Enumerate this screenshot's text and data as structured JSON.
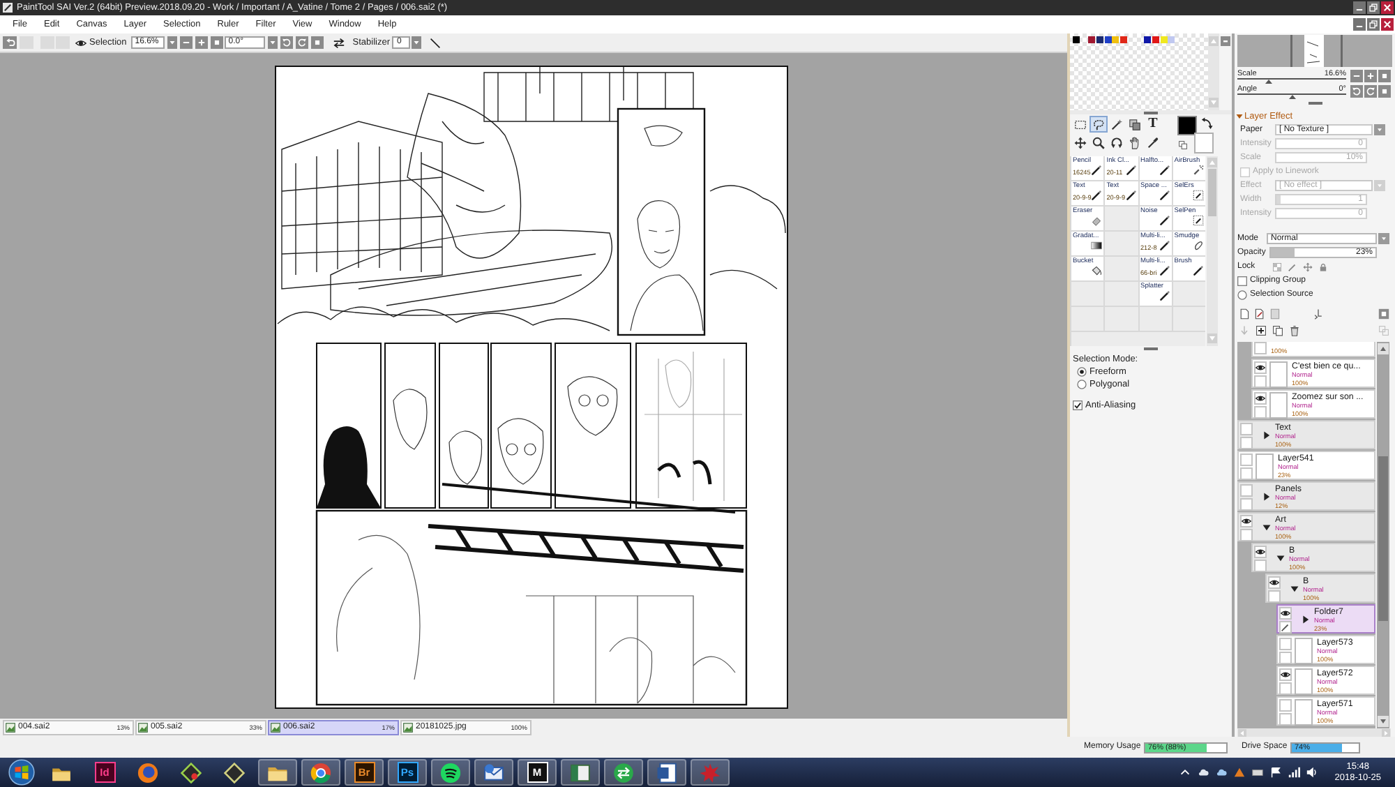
{
  "window": {
    "title": "PaintTool SAI Ver.2 (64bit) Preview.2018.09.20 - Work / Important / A_Vatine / Tome 2 / Pages / 006.sai2 (*)"
  },
  "menu": [
    {
      "label": "File"
    },
    {
      "label": "Edit"
    },
    {
      "label": "Canvas"
    },
    {
      "label": "Layer"
    },
    {
      "label": "Selection"
    },
    {
      "label": "Ruler"
    },
    {
      "label": "Filter"
    },
    {
      "label": "View"
    },
    {
      "label": "Window"
    },
    {
      "label": "Help"
    }
  ],
  "toolbar": {
    "history_buttons": [
      {
        "disabled": false
      },
      {
        "disabled": true
      },
      {
        "disabled": true
      },
      {
        "disabled": true
      }
    ],
    "selection_label": "Selection",
    "zoom": "16.6%",
    "angle": "0.0°",
    "stabilizer_label": "Stabilizer",
    "stabilizer": "0"
  },
  "documents": [
    {
      "name": "004.sai2",
      "zoom": "13%",
      "selected": false
    },
    {
      "name": "005.sai2",
      "zoom": "33%",
      "selected": false
    },
    {
      "name": "006.sai2",
      "zoom": "17%",
      "selected": true
    },
    {
      "name": "20181025.jpg",
      "zoom": "100%",
      "selected": false
    }
  ],
  "palette": {
    "swatches": [
      {
        "kind": "color",
        "color": "#000000"
      },
      {
        "kind": "empty"
      },
      {
        "kind": "color",
        "color": "#a01830"
      },
      {
        "kind": "color",
        "color": "#1a2a70"
      },
      {
        "kind": "color",
        "color": "#2040c8"
      },
      {
        "kind": "color",
        "color": "#f0c010"
      },
      {
        "kind": "color",
        "color": "#e02818"
      },
      {
        "kind": "empty"
      },
      {
        "kind": "empty"
      },
      {
        "kind": "color",
        "color": "#1018a8"
      },
      {
        "kind": "color",
        "color": "#e01818"
      },
      {
        "kind": "color",
        "color": "#f0e820"
      },
      {
        "kind": "color",
        "color": "#c0c8f0"
      }
    ]
  },
  "tools": [
    {
      "kind": "icon",
      "selected": false
    },
    {
      "kind": "icon",
      "selected": true
    },
    {
      "kind": "icon",
      "selected": false
    },
    {
      "kind": "icon",
      "selected": false
    },
    {
      "kind": "glyph",
      "glyph": "T",
      "selected": false
    },
    {
      "kind": "icon",
      "selected": false
    },
    {
      "kind": "icon",
      "selected": false
    },
    {
      "kind": "icon",
      "selected": false
    },
    {
      "kind": "icon",
      "selected": false
    },
    {
      "kind": "icon",
      "selected": false
    }
  ],
  "colors": [
    {
      "color": "#000000"
    },
    {
      "color": "#ffffff"
    }
  ],
  "brushes": [
    {
      "kind": "brush",
      "name": "Pencil",
      "size": "16245"
    },
    {
      "kind": "brush",
      "name": "Ink Cl...",
      "size": "20-11"
    },
    {
      "kind": "brush",
      "name": "Halfto..."
    },
    {
      "kind": "brush",
      "name": "AirBrush"
    },
    {
      "kind": "brush",
      "name": "Text",
      "size": "20-9-9"
    },
    {
      "kind": "brush",
      "name": "Text",
      "size": "20-9-9"
    },
    {
      "kind": "brush",
      "name": "Space ..."
    },
    {
      "kind": "brush",
      "name": "SelErs"
    },
    {
      "kind": "brush",
      "name": "Eraser"
    },
    {
      "kind": "empty"
    },
    {
      "kind": "brush",
      "name": "Noise"
    },
    {
      "kind": "brush",
      "name": "SelPen"
    },
    {
      "kind": "brush",
      "name": "Gradat..."
    },
    {
      "kind": "empty"
    },
    {
      "kind": "brush",
      "name": "Multi-li...",
      "size": "212-8"
    },
    {
      "kind": "brush",
      "name": "Smudge"
    },
    {
      "kind": "brush",
      "name": "Bucket"
    },
    {
      "kind": "empty"
    },
    {
      "kind": "brush",
      "name": "Multi-li...",
      "size": "66-bri"
    },
    {
      "kind": "brush",
      "name": "Brush"
    },
    {
      "kind": "empty"
    },
    {
      "kind": "empty"
    },
    {
      "kind": "brush",
      "name": "Splatter"
    },
    {
      "kind": "empty"
    },
    {
      "kind": "empty"
    },
    {
      "kind": "empty"
    },
    {
      "kind": "empty"
    },
    {
      "kind": "empty"
    }
  ],
  "selection_mode": {
    "label": "Selection Mode:",
    "options": [
      {
        "label": "Freeform",
        "selected": true
      },
      {
        "label": "Polygonal",
        "selected": false
      }
    ],
    "anti_aliasing": {
      "label": "Anti-Aliasing",
      "checked": true
    }
  },
  "navigator": {
    "scale": {
      "label": "Scale",
      "value": "16.6%",
      "level": 0.29
    },
    "angle": {
      "label": "Angle",
      "value": "0°",
      "level": 0.5
    }
  },
  "layer_effect": {
    "title": "Layer Effect",
    "expanded": true,
    "rows": [
      {
        "kind": "dropdown",
        "label": "Paper",
        "value": "[ No Texture ]",
        "disabled": false
      },
      {
        "kind": "slider",
        "label": "Intensity",
        "value": "0",
        "disabled": true
      },
      {
        "kind": "slider",
        "label": "Scale",
        "value": "10%",
        "disabled": true
      },
      {
        "kind": "checkbox",
        "label": "Apply to Linework",
        "checked": false,
        "disabled": true
      },
      {
        "kind": "dropdown",
        "label": "Effect",
        "value": "[ No effect ]",
        "disabled": true
      },
      {
        "kind": "slider",
        "label": "Width",
        "value": "1",
        "level": 0.05,
        "disabled": true
      },
      {
        "kind": "slider",
        "label": "Intensity",
        "value": "0",
        "disabled": true
      }
    ]
  },
  "layer_properties": {
    "mode": {
      "label": "Mode",
      "value": "Normal"
    },
    "opacity": {
      "label": "Opacity",
      "value": "23%",
      "level": 0.23
    },
    "lock": {
      "label": "Lock"
    },
    "clipping_group": {
      "label": "Clipping Group",
      "checked": false
    },
    "selection_source": {
      "label": "Selection Source",
      "checked": false
    }
  },
  "layers": [
    {
      "kind": "offscreen",
      "children": [
        {
          "kind": "layer",
          "opacity": "100%",
          "selected": false
        },
        {
          "kind": "layer",
          "name": "C'est bien ce qu...",
          "mode": "Normal",
          "opacity": "100%",
          "visible": true,
          "selected": false
        },
        {
          "kind": "layer",
          "name": "Zoomez sur son ...",
          "mode": "Normal",
          "opacity": "100%",
          "visible": true,
          "selected": false
        }
      ]
    },
    {
      "kind": "folder",
      "name": "Text",
      "mode": "Normal",
      "opacity": "100%",
      "visible": false,
      "selected": false,
      "expanded": false
    },
    {
      "kind": "layer",
      "name": "Layer541",
      "mode": "Normal",
      "opacity": "23%",
      "visible": false,
      "selected": false
    },
    {
      "kind": "folder",
      "name": "Panels",
      "mode": "Normal",
      "opacity": "12%",
      "visible": false,
      "selected": false,
      "expanded": false
    },
    {
      "kind": "folder",
      "name": "Art",
      "mode": "Normal",
      "opacity": "100%",
      "visible": true,
      "selected": false,
      "expanded": true,
      "children": [
        {
          "kind": "folder",
          "name": "B",
          "mode": "Normal",
          "opacity": "100%",
          "visible": true,
          "selected": false,
          "expanded": true,
          "children": [
            {
              "kind": "folder",
              "name": "B",
              "mode": "Normal",
              "opacity": "100%",
              "visible": true,
              "selected": false,
              "expanded": true,
              "children": [
                {
                  "kind": "folder",
                  "name": "Folder7",
                  "mode": "Normal",
                  "opacity": "23%",
                  "visible": true,
                  "selected": true,
                  "expanded": false
                },
                {
                  "kind": "layer",
                  "name": "Layer573",
                  "mode": "Normal",
                  "opacity": "100%",
                  "visible": false,
                  "selected": false
                },
                {
                  "kind": "layer",
                  "name": "Layer572",
                  "mode": "Normal",
                  "opacity": "100%",
                  "visible": true,
                  "selected": false
                },
                {
                  "kind": "layer",
                  "name": "Layer571",
                  "mode": "Normal",
                  "opacity": "100%",
                  "visible": false,
                  "selected": false
                }
              ]
            }
          ]
        }
      ]
    }
  ],
  "status_bar": {
    "memory": {
      "label": "Memory Usage",
      "value": "76% (88%)",
      "level": 0.76
    },
    "drive": {
      "label": "Drive Space",
      "value": "74%",
      "level": 0.74
    }
  },
  "taskbar": {
    "apps": [
      {
        "running": false
      },
      {
        "label": "Id",
        "running": false
      },
      {
        "running": false
      },
      {
        "running": false
      },
      {
        "running": false
      },
      {
        "running": true
      },
      {
        "running": true
      },
      {
        "label": "Br",
        "running": true
      },
      {
        "label": "Ps",
        "running": true
      },
      {
        "running": true
      },
      {
        "running": true
      },
      {
        "label": "M",
        "running": true
      },
      {
        "running": true
      },
      {
        "running": true
      },
      {
        "running": true
      },
      {
        "running": true
      }
    ],
    "time": "15:48",
    "date": "2018-10-25"
  }
}
